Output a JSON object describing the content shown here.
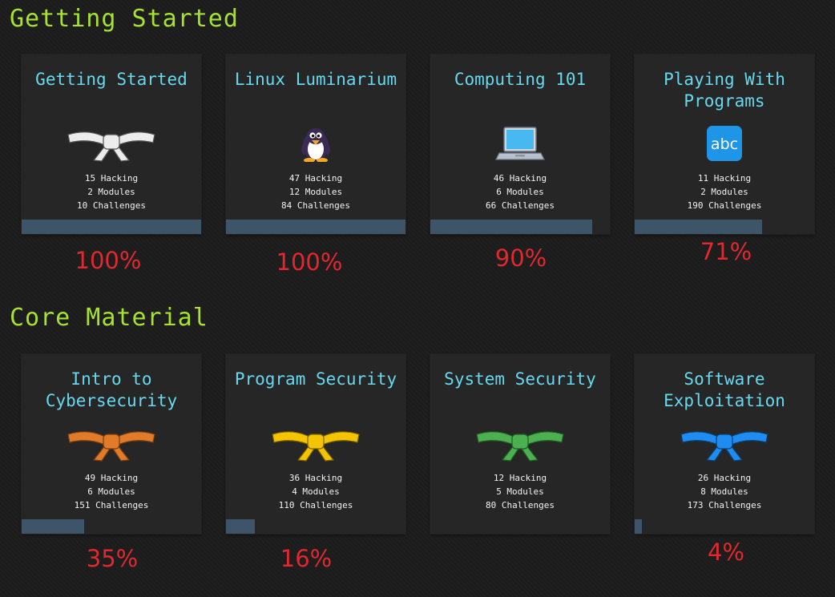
{
  "sections": [
    {
      "title": "Getting Started",
      "cards": [
        {
          "title": "Getting Started",
          "icon": "white-belt-icon",
          "stats": [
            "15 Hacking",
            "2 Modules",
            "10 Challenges"
          ],
          "progress": 1.0,
          "percent": "100%"
        },
        {
          "title": "Linux Luminarium",
          "icon": "penguin-icon",
          "stats": [
            "47 Hacking",
            "12 Modules",
            "84 Challenges"
          ],
          "progress": 1.0,
          "percent": "100%"
        },
        {
          "title": "Computing 101",
          "icon": "laptop-icon",
          "stats": [
            "46 Hacking",
            "6 Modules",
            "66 Challenges"
          ],
          "progress": 0.9,
          "percent": "90%"
        },
        {
          "title": "Playing With Programs",
          "icon": "abc-icon",
          "stats": [
            "11 Hacking",
            "2 Modules",
            "190 Challenges"
          ],
          "progress": 0.71,
          "percent": "71%"
        }
      ]
    },
    {
      "title": "Core Material",
      "cards": [
        {
          "title": "Intro to Cybersecurity",
          "icon": "orange-belt-icon",
          "stats": [
            "49 Hacking",
            "6 Modules",
            "151 Challenges"
          ],
          "progress": 0.35,
          "percent": "35%"
        },
        {
          "title": "Program Security",
          "icon": "yellow-belt-icon",
          "stats": [
            "36 Hacking",
            "4 Modules",
            "110 Challenges"
          ],
          "progress": 0.16,
          "percent": "16%"
        },
        {
          "title": "System Security",
          "icon": "green-belt-icon",
          "stats": [
            "12 Hacking",
            "5 Modules",
            "80 Challenges"
          ],
          "progress": 0.0,
          "percent": ""
        },
        {
          "title": "Software Exploitation",
          "icon": "blue-belt-icon",
          "stats": [
            "26 Hacking",
            "8 Modules",
            "173 Challenges"
          ],
          "progress": 0.04,
          "percent": "4%"
        }
      ]
    }
  ],
  "colors": {
    "section_title": "#a6e22e",
    "card_title": "#66d9ef",
    "percent": "#e0282e",
    "progress_fill": "#3e5468",
    "white_belt": "#ececec",
    "orange_belt": "#e07b2a",
    "yellow_belt": "#f5c400",
    "green_belt": "#4caf50",
    "blue_belt": "#1e8cf0"
  }
}
